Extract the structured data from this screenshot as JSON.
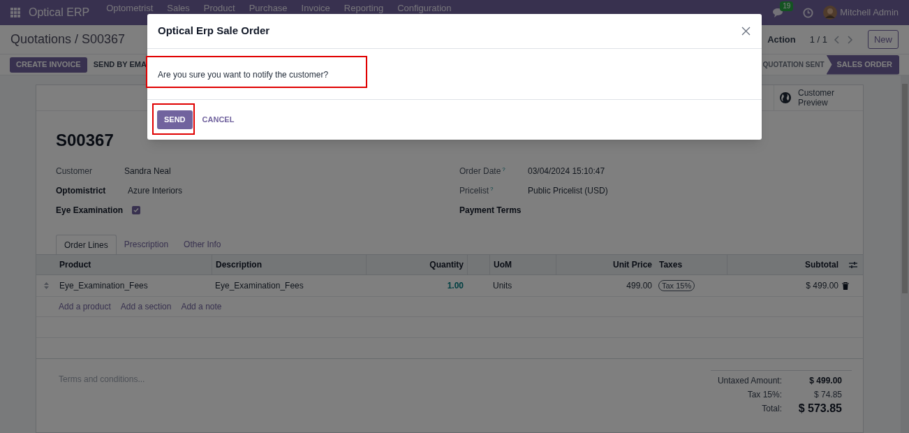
{
  "navbar": {
    "app_name": "Optical ERP",
    "menu": [
      "Optometrist",
      "Sales",
      "Product",
      "Purchase",
      "Invoice",
      "Reporting",
      "Configuration"
    ],
    "message_count": "19",
    "user": "Mitchell Admin"
  },
  "control_panel": {
    "breadcrumb": "Quotations / S00367",
    "action": "Action",
    "pager": "1 / 1",
    "new_button": "New"
  },
  "action_buttons": [
    {
      "label": "CREATE INVOICE",
      "kind": "primary"
    },
    {
      "label": "SEND BY EMA",
      "kind": "secondary"
    }
  ],
  "status_stages": [
    {
      "label": "QUOTATION SENT",
      "selected": false
    },
    {
      "label": "SALES ORDER",
      "selected": true
    }
  ],
  "smart_button": "Customer Preview",
  "title": "S00367",
  "fields_left": [
    {
      "label": "Customer",
      "required": false,
      "kind": "text",
      "value": "Sandra Neal"
    },
    {
      "label": "Optomistrict",
      "required": true,
      "kind": "text",
      "value": "Azure Interiors"
    },
    {
      "label": "Eye Examination",
      "required": true,
      "kind": "checkbox",
      "checked": true
    }
  ],
  "fields_right": [
    {
      "label": "Order Date",
      "help": "?",
      "required": false,
      "value": "03/04/2024 15:10:47"
    },
    {
      "label": "Pricelist",
      "help": "?",
      "required": false,
      "value": "Public Pricelist (USD)"
    },
    {
      "label": "Payment Terms",
      "required": true
    }
  ],
  "tabs": [
    {
      "label": "Order Lines",
      "selected": true
    },
    {
      "label": "Prescription",
      "selected": false
    },
    {
      "label": "Other Info",
      "selected": false
    }
  ],
  "table": {
    "columns": [
      "Product",
      "Description",
      "Quantity",
      "UoM",
      "Unit Price",
      "Taxes",
      "Subtotal"
    ],
    "rows": [
      {
        "product": "Eye_Examination_Fees",
        "description": "Eye_Examination_Fees",
        "quantity": "1.00",
        "uom": "Units",
        "unit_price": "499.00",
        "taxes": [
          "Tax 15%"
        ],
        "subtotal": "$ 499.00"
      }
    ],
    "add_links": [
      "Add a product",
      "Add a section",
      "Add a note"
    ]
  },
  "terms_placeholder": "Terms and conditions...",
  "totals": [
    {
      "label": "Untaxed Amount:",
      "value": "$ 499.00",
      "kind": "strong"
    },
    {
      "label": "Tax 15%:",
      "value": "$ 74.85",
      "kind": "normal"
    },
    {
      "label": "Total:",
      "value": "$ 573.85",
      "kind": "total"
    }
  ],
  "dialog": {
    "title": "Optical Erp Sale Order",
    "message": "Are you sure you want to notify the customer?",
    "buttons": [
      {
        "label": "SEND",
        "kind": "primary"
      },
      {
        "label": "CANCEL",
        "kind": "link"
      }
    ]
  }
}
